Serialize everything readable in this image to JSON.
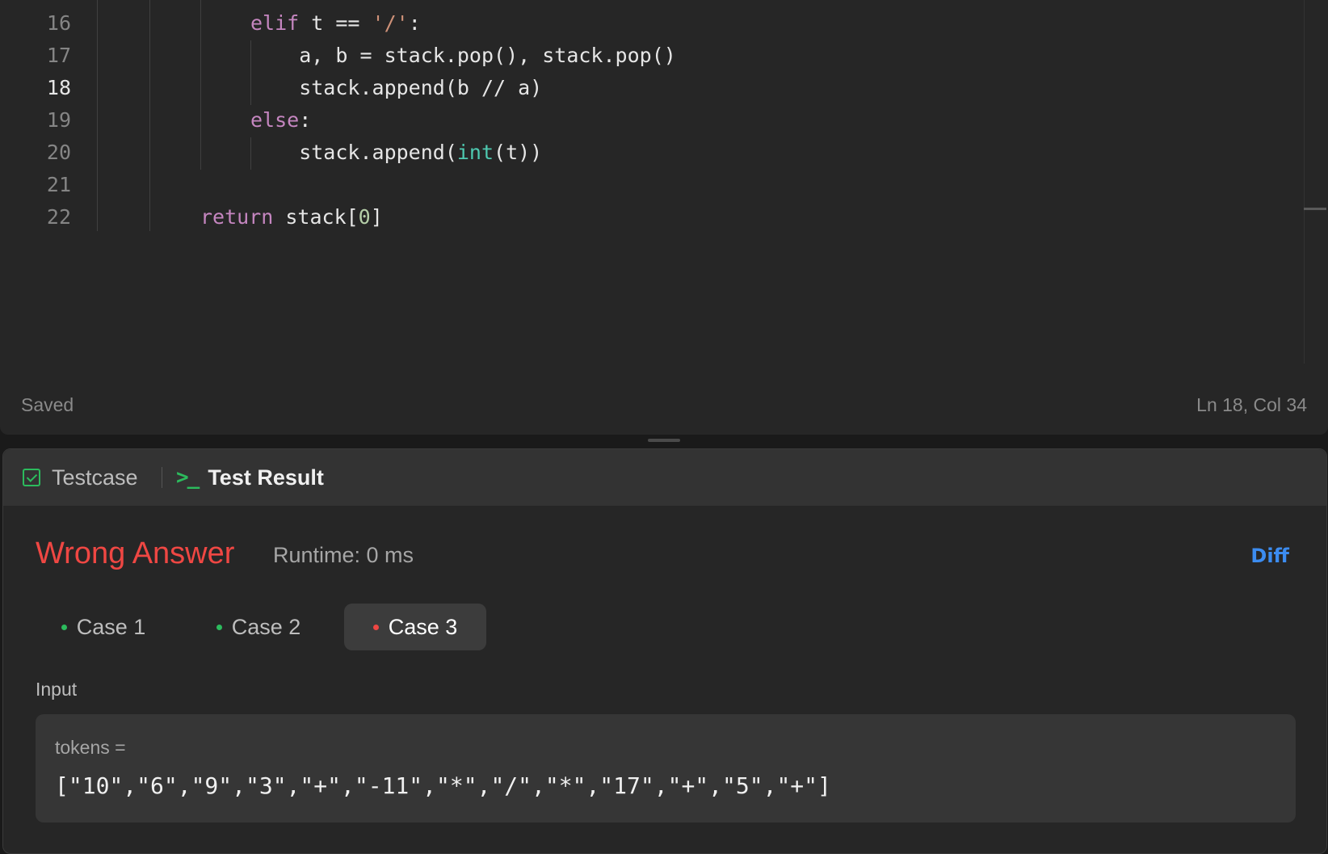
{
  "editor": {
    "lines": [
      {
        "no": "16",
        "html": "<span class=\"kw\">elif</span> t == <span class=\"str\">'/'</span>:"
      },
      {
        "no": "17",
        "html": "    a, b = stack.pop(), stack.pop()"
      },
      {
        "no": "18",
        "html": "    stack.append(b // a)"
      },
      {
        "no": "19",
        "html": "<span class=\"kw\">else</span>:"
      },
      {
        "no": "20",
        "html": "    stack.append(<span class=\"bi\">int</span>(t))"
      },
      {
        "no": "21",
        "html": ""
      },
      {
        "no": "22",
        "html": "<span class=\"kw\">return</span> stack[<span class=\"num\">0</span>]"
      }
    ],
    "active_line": "18",
    "status_left": "Saved",
    "status_right": "Ln 18, Col 34"
  },
  "panel": {
    "tabs": {
      "testcase": "Testcase",
      "test_result": "Test Result"
    },
    "verdict": "Wrong Answer",
    "runtime": "Runtime: 0 ms",
    "diff_label": "Diff",
    "cases": [
      {
        "label": "Case 1",
        "status": "pass"
      },
      {
        "label": "Case 2",
        "status": "pass"
      },
      {
        "label": "Case 3",
        "status": "fail"
      }
    ],
    "selected_case": "Case 3",
    "input_label": "Input",
    "input_var": "tokens =",
    "input_value": "[\"10\",\"6\",\"9\",\"3\",\"+\",\"-11\",\"*\",\"/\",\"*\",\"17\",\"+\",\"5\",\"+\"]"
  },
  "colors": {
    "wrong": "#ef4743",
    "pass": "#2cbb5d",
    "fail": "#ef4743",
    "link": "#3c8cf0"
  }
}
